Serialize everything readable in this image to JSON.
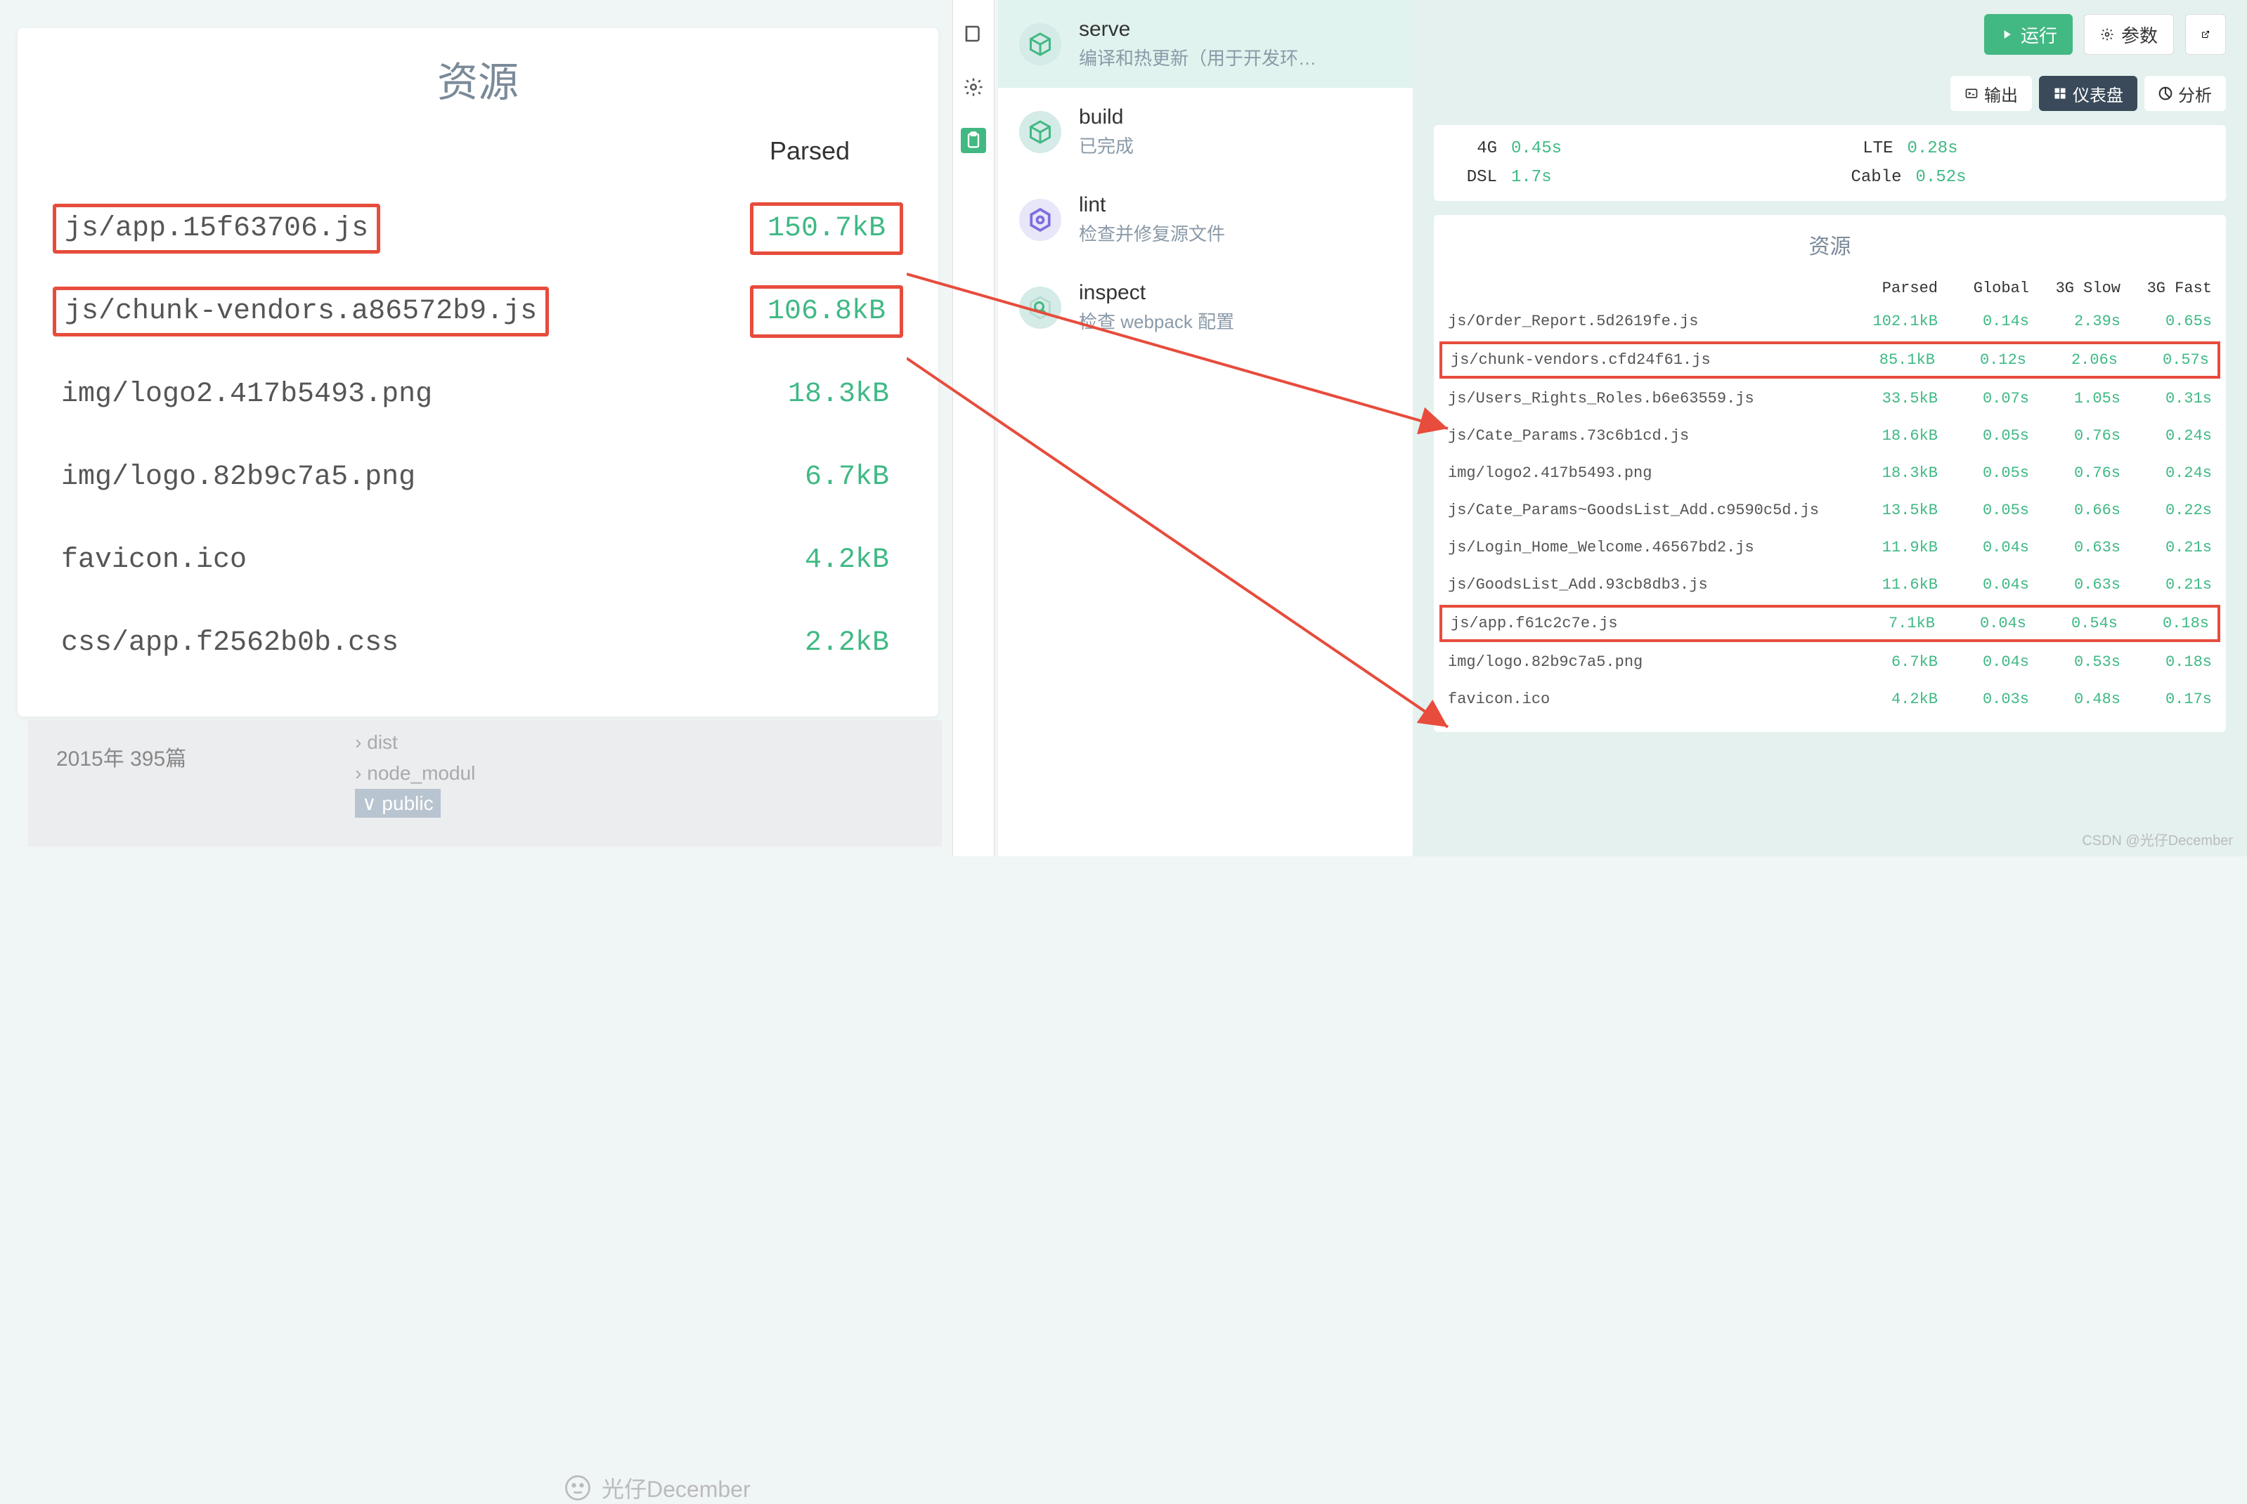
{
  "left": {
    "title": "资源",
    "header_parsed": "Parsed",
    "rows": [
      {
        "name": "js/app.15f63706.js",
        "parsed": "150.7kB",
        "highlight": true
      },
      {
        "name": "js/chunk-vendors.a86572b9.js",
        "parsed": "106.8kB",
        "highlight": true
      },
      {
        "name": "img/logo2.417b5493.png",
        "parsed": "18.3kB",
        "highlight": false
      },
      {
        "name": "img/logo.82b9c7a5.png",
        "parsed": "6.7kB",
        "highlight": false
      },
      {
        "name": "favicon.ico",
        "parsed": "4.2kB",
        "highlight": false
      },
      {
        "name": "css/app.f2562b0b.css",
        "parsed": "2.2kB",
        "highlight": false
      }
    ]
  },
  "archive": {
    "year_count": "2015年 395篇",
    "tree": [
      "dist",
      "node_modul",
      "public"
    ]
  },
  "watermark_left": "光仔December",
  "tasks": [
    {
      "name": "serve",
      "desc": "编译和热更新（用于开发环…",
      "icon": "cube",
      "selected": true
    },
    {
      "name": "build",
      "desc": "已完成",
      "icon": "cube",
      "selected": false
    },
    {
      "name": "lint",
      "desc": "检查并修复源文件",
      "icon": "hex",
      "selected": false
    },
    {
      "name": "inspect",
      "desc": "检查 webpack 配置",
      "icon": "search",
      "selected": false
    }
  ],
  "toolbar": {
    "run": "运行",
    "params": "参数"
  },
  "view_tabs": {
    "output": "输出",
    "dashboard": "仪表盘",
    "analyze": "分析"
  },
  "network": [
    {
      "label": "4G",
      "val": "0.45s"
    },
    {
      "label": "LTE",
      "val": "0.28s"
    },
    {
      "label": "DSL",
      "val": "1.7s"
    },
    {
      "label": "Cable",
      "val": "0.52s"
    }
  ],
  "resources": {
    "title": "资源",
    "headers": [
      "Parsed",
      "Global",
      "3G Slow",
      "3G Fast"
    ],
    "rows": [
      {
        "name": "js/Order_Report.5d2619fe.js",
        "parsed": "102.1kB",
        "global": "0.14s",
        "slow": "2.39s",
        "fast": "0.65s",
        "hl": false
      },
      {
        "name": "js/chunk-vendors.cfd24f61.js",
        "parsed": "85.1kB",
        "global": "0.12s",
        "slow": "2.06s",
        "fast": "0.57s",
        "hl": true
      },
      {
        "name": "js/Users_Rights_Roles.b6e63559.js",
        "parsed": "33.5kB",
        "global": "0.07s",
        "slow": "1.05s",
        "fast": "0.31s",
        "hl": false
      },
      {
        "name": "js/Cate_Params.73c6b1cd.js",
        "parsed": "18.6kB",
        "global": "0.05s",
        "slow": "0.76s",
        "fast": "0.24s",
        "hl": false
      },
      {
        "name": "img/logo2.417b5493.png",
        "parsed": "18.3kB",
        "global": "0.05s",
        "slow": "0.76s",
        "fast": "0.24s",
        "hl": false
      },
      {
        "name": "js/Cate_Params~GoodsList_Add.c9590c5d.js",
        "parsed": "13.5kB",
        "global": "0.05s",
        "slow": "0.66s",
        "fast": "0.22s",
        "hl": false
      },
      {
        "name": "js/Login_Home_Welcome.46567bd2.js",
        "parsed": "11.9kB",
        "global": "0.04s",
        "slow": "0.63s",
        "fast": "0.21s",
        "hl": false
      },
      {
        "name": "js/GoodsList_Add.93cb8db3.js",
        "parsed": "11.6kB",
        "global": "0.04s",
        "slow": "0.63s",
        "fast": "0.21s",
        "hl": false
      },
      {
        "name": "js/app.f61c2c7e.js",
        "parsed": "7.1kB",
        "global": "0.04s",
        "slow": "0.54s",
        "fast": "0.18s",
        "hl": true
      },
      {
        "name": "img/logo.82b9c7a5.png",
        "parsed": "6.7kB",
        "global": "0.04s",
        "slow": "0.53s",
        "fast": "0.18s",
        "hl": false
      },
      {
        "name": "favicon.ico",
        "parsed": "4.2kB",
        "global": "0.03s",
        "slow": "0.48s",
        "fast": "0.17s",
        "hl": false
      }
    ]
  },
  "watermark_right": "CSDN @光仔December"
}
